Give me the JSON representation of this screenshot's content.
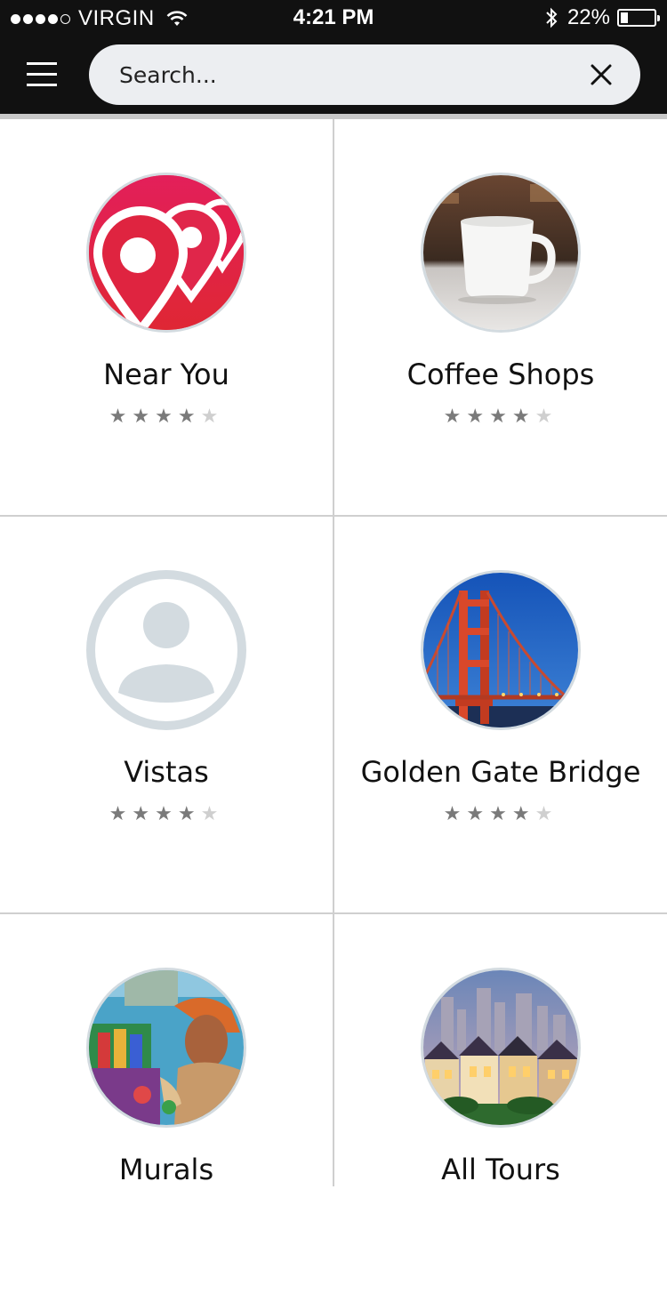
{
  "status": {
    "carrier": "VIRGIN",
    "time": "4:21 PM",
    "battery_pct": "22%",
    "battery_level": 0.22
  },
  "search": {
    "placeholder": "Search..."
  },
  "colors": {
    "bar": "#111111",
    "search_bg": "#eceef1",
    "divider": "#cfcfcf",
    "pin_red": "#e0263f",
    "placeholder_gray": "#d3dbe0"
  },
  "cards": [
    {
      "title": "Near You",
      "rating": 4,
      "max": 5,
      "icon": "map-pin-icon"
    },
    {
      "title": "Coffee Shops",
      "rating": 4,
      "max": 5,
      "icon": "coffee-cup-image"
    },
    {
      "title": "Vistas",
      "rating": 4,
      "max": 5,
      "icon": "user-placeholder-icon"
    },
    {
      "title": "Golden Gate Bridge",
      "rating": 4,
      "max": 5,
      "icon": "bridge-image"
    },
    {
      "title": "Murals",
      "icon": "mural-image"
    },
    {
      "title": "All Tours",
      "icon": "painted-ladies-image"
    }
  ]
}
